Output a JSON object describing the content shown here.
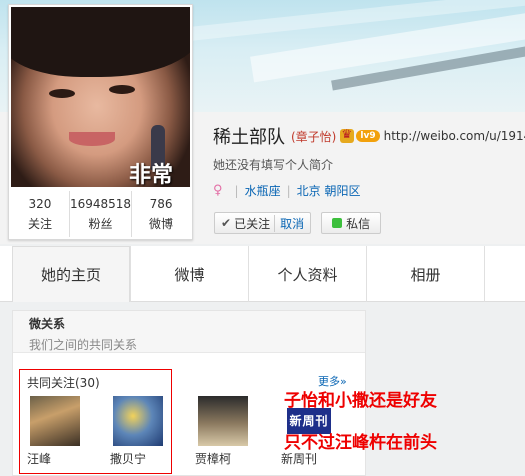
{
  "profile": {
    "nickname": "稀土部队",
    "real_name": "(章子怡)",
    "level": "lv9",
    "url": "http://weibo.com/u/1914",
    "bio": "她还没有填写个人简介",
    "constellation": "水瓶座",
    "location": "北京 朝阳区",
    "avatar_poster_text": "非常"
  },
  "stats": [
    {
      "value": "320",
      "label": "关注"
    },
    {
      "value": "16948518",
      "label": "粉丝"
    },
    {
      "value": "786",
      "label": "微博"
    }
  ],
  "actions": {
    "followed_label": "已关注",
    "cancel_label": "取消",
    "message_label": "私信"
  },
  "tabs": [
    {
      "label": "她的主页",
      "active": true
    },
    {
      "label": "微博",
      "active": false
    },
    {
      "label": "个人资料",
      "active": false
    },
    {
      "label": "相册",
      "active": false
    }
  ],
  "relations": {
    "title": "微关系",
    "subtitle": "我们之间的共同关系",
    "mutual_title": "共同关注(30)",
    "more": "更多»",
    "friends": [
      {
        "name": "汪峰"
      },
      {
        "name": "撒贝宁"
      },
      {
        "name": "贾樟柯"
      },
      {
        "name": "新周刊",
        "logo_text": "新周刊"
      }
    ]
  },
  "annotation": {
    "line1": "子怡和小撒还是好友",
    "line2": "只不过汪峰杵在前头"
  },
  "colors": {
    "annotation": "#ee0000",
    "link": "#0a66b4",
    "level_badge": "#f2a10c"
  }
}
